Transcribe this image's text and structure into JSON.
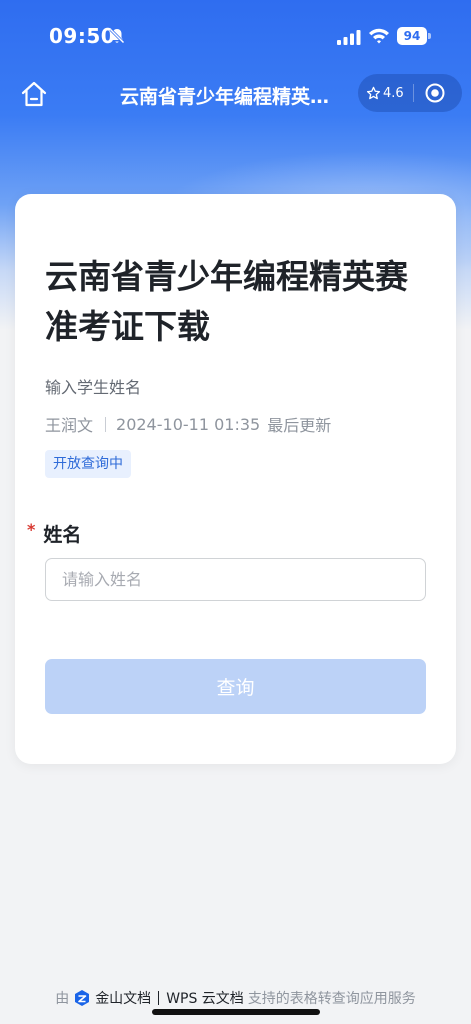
{
  "status_bar": {
    "time": "09:50",
    "battery": "94",
    "icons": [
      "mute-bell-icon",
      "cellular-signal-icon",
      "wifi-icon",
      "battery-icon"
    ]
  },
  "nav": {
    "title": "云南省青少年编程精英…",
    "rating": "4.6",
    "icons": [
      "home-icon",
      "star-icon",
      "target-icon"
    ]
  },
  "form": {
    "title": "云南省青少年编程精英赛准考证下载",
    "subtitle": "输入学生姓名",
    "author": "王润文",
    "updated_time": "2024-10-11 01:35",
    "updated_label": "最后更新",
    "status_badge": "开放查询中",
    "required_mark": "*",
    "field_label": "姓名",
    "field_placeholder": "请输入姓名",
    "field_value": "",
    "submit_label": "查询"
  },
  "footer": {
    "prefix": "由",
    "brand": "金山文档",
    "product": "WPS 云文档",
    "suffix": "支持的表格转查询应用服务"
  },
  "colors": {
    "header_blue": "#2f6df0",
    "button_disabled": "#bcd2f7",
    "badge_bg": "#e8f0fe",
    "badge_text": "#2f6bd8",
    "required_red": "#d83931"
  }
}
